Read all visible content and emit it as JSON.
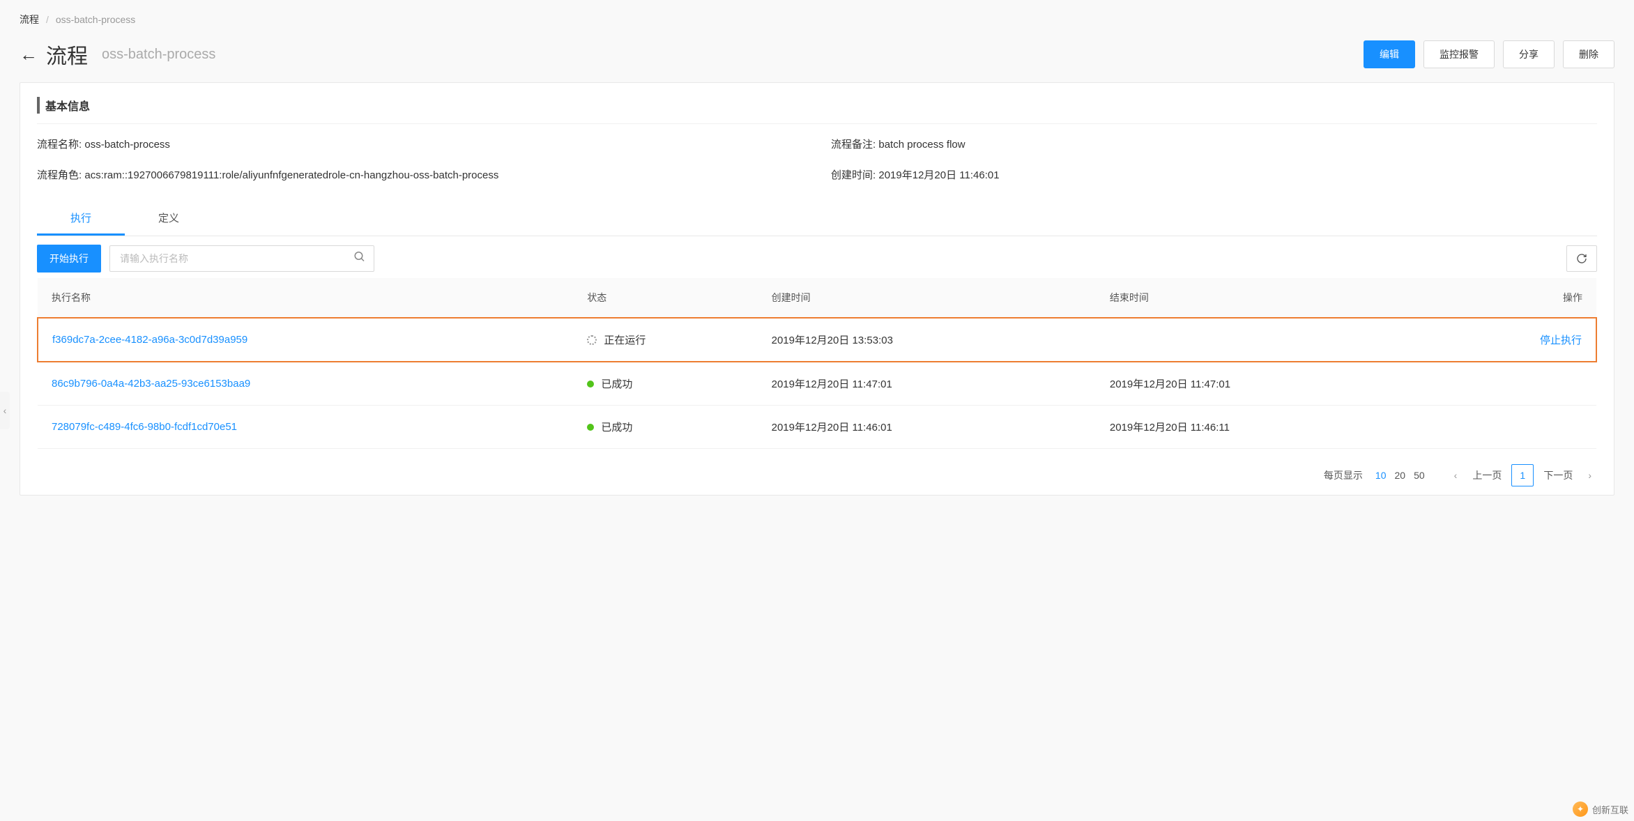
{
  "breadcrumb": {
    "root": "流程",
    "current": "oss-batch-process"
  },
  "header": {
    "title": "流程",
    "subtitle": "oss-batch-process",
    "buttons": {
      "edit": "编辑",
      "monitor": "监控报警",
      "share": "分享",
      "delete": "删除"
    }
  },
  "basic_info": {
    "heading": "基本信息",
    "fields": {
      "name_label": "流程名称",
      "name_value": "oss-batch-process",
      "remark_label": "流程备注",
      "remark_value": "batch process flow",
      "role_label": "流程角色",
      "role_value": "acs:ram::1927006679819111:role/aliyunfnfgeneratedrole-cn-hangzhou-oss-batch-process",
      "created_label": "创建时间",
      "created_value": "2019年12月20日 11:46:01"
    }
  },
  "tabs": {
    "execute": "执行",
    "define": "定义"
  },
  "toolbar": {
    "start_label": "开始执行",
    "search_placeholder": "请输入执行名称"
  },
  "columns": {
    "name": "执行名称",
    "status": "状态",
    "created": "创建时间",
    "ended": "结束时间",
    "action": "操作"
  },
  "rows": [
    {
      "name": "f369dc7a-2cee-4182-a96a-3c0d7d39a959",
      "status_state": "running",
      "status_text": "正在运行",
      "created": "2019年12月20日 13:53:03",
      "ended": "",
      "action": "停止执行",
      "highlight": true
    },
    {
      "name": "86c9b796-0a4a-42b3-aa25-93ce6153baa9",
      "status_state": "success",
      "status_text": "已成功",
      "created": "2019年12月20日 11:47:01",
      "ended": "2019年12月20日 11:47:01",
      "action": "",
      "highlight": false
    },
    {
      "name": "728079fc-c489-4fc6-98b0-fcdf1cd70e51",
      "status_state": "success",
      "status_text": "已成功",
      "created": "2019年12月20日 11:46:01",
      "ended": "2019年12月20日 11:46:11",
      "action": "",
      "highlight": false
    }
  ],
  "pagination": {
    "per_page_label": "每页显示",
    "sizes": [
      "10",
      "20",
      "50"
    ],
    "active_size": "10",
    "prev": "上一页",
    "next": "下一页",
    "current": "1"
  },
  "watermark": "创新互联"
}
